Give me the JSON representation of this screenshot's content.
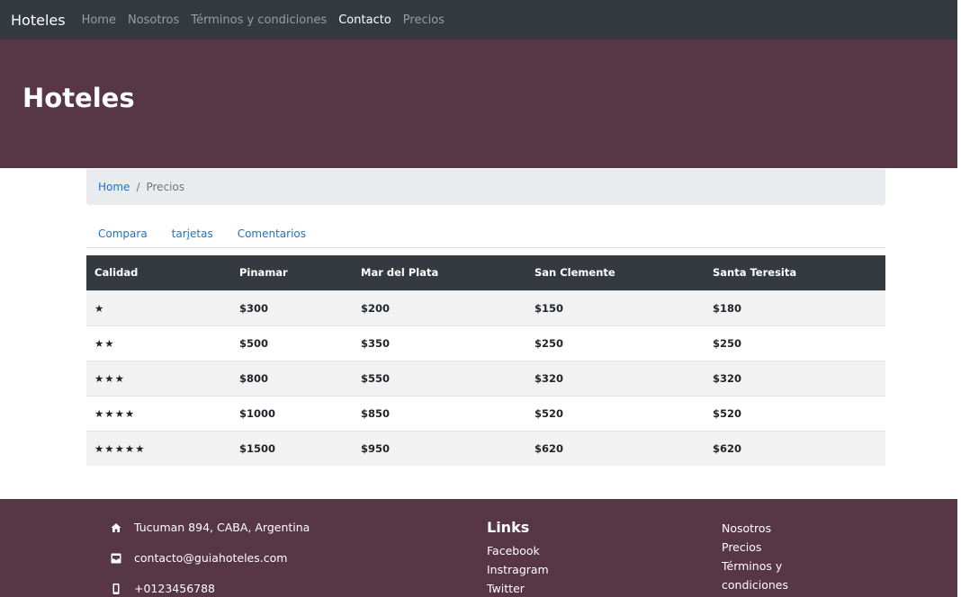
{
  "navbar": {
    "brand": "Hoteles",
    "links": [
      {
        "label": "Home",
        "active": false
      },
      {
        "label": "Nosotros",
        "active": false
      },
      {
        "label": "Términos y condiciones",
        "active": false
      },
      {
        "label": "Contacto",
        "active": true
      },
      {
        "label": "Precios",
        "active": false
      }
    ]
  },
  "hero": {
    "title": "Hoteles"
  },
  "breadcrumb": {
    "home": "Home",
    "separator": "/",
    "current": "Precios"
  },
  "tabs": [
    "Compara",
    "tarjetas",
    "Comentarios"
  ],
  "table": {
    "headers": [
      "Calidad",
      "Pinamar",
      "Mar del Plata",
      "San Clemente",
      "Santa Teresita"
    ],
    "rows": [
      [
        "★",
        "$300",
        "$200",
        "$150",
        "$180"
      ],
      [
        "★★",
        "$500",
        "$350",
        "$250",
        "$250"
      ],
      [
        "★★★",
        "$800",
        "$550",
        "$320",
        "$320"
      ],
      [
        "★★★★",
        "$1000",
        "$850",
        "$520",
        "$520"
      ],
      [
        "★★★★★",
        "$1500",
        "$950",
        "$620",
        "$620"
      ]
    ]
  },
  "footer": {
    "address": "Tucuman 894, CABA, Argentina",
    "email": "contacto@guiahoteles.com",
    "phone": "+0123456788",
    "links_title": "Links",
    "social": [
      "Facebook",
      "Instragram",
      "Twitter"
    ],
    "pages": [
      "Nosotros",
      "Precios",
      "Términos y condiciones"
    ]
  },
  "colors": {
    "navbar": "#343a40",
    "hero": "#573645",
    "link": "#1d72c9",
    "breadcrumb_bg": "#e9ecef"
  }
}
